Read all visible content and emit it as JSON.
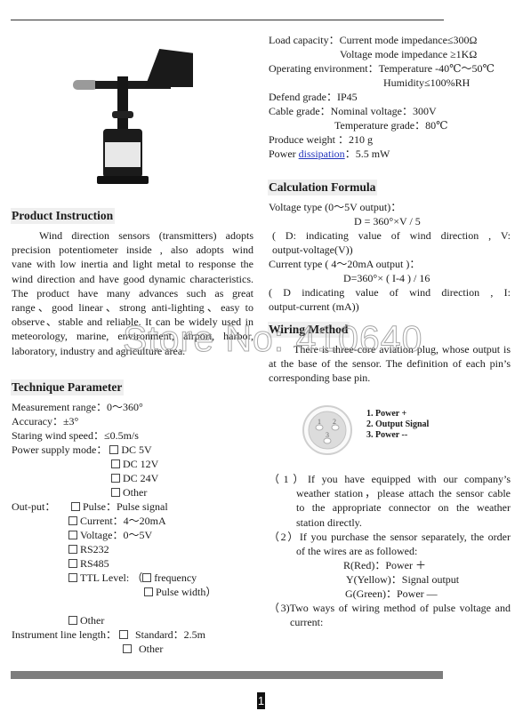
{
  "watermark": "Store No: 410640",
  "page_number": "1",
  "product_photo": {
    "label": "wind direction sensor photo"
  },
  "product_instruction": {
    "heading": "Product Instruction",
    "paragraph_lines": [
      "Wind direction sensors (transmitters) adopts",
      "precision potentiometer inside , also adopts wind",
      "vane with low inertia and light metal to response the",
      "wind direction and have good dynamic characteristics.",
      "The product have many advances such as great",
      "range、good linear、strong anti-lighting、easy to",
      "observe、stable and reliable. It can be widely used in",
      "meteorology, marine, environment, airport, harbor,",
      "laboratory, industry and agriculture area."
    ]
  },
  "technique_parameter": {
    "heading": "Technique Parameter",
    "measurement_range": "Measurement range：0～360°",
    "accuracy": "Accuracy：±3°",
    "starting_wind_speed": "Staring wind speed：≤0.5m/s",
    "power_supply_label": "Power supply mode：",
    "power_supply_options": [
      "DC 5V",
      "DC 12V",
      "DC 24V",
      "Other"
    ],
    "output_label": "Out-put：",
    "output_options": [
      "Pulse：Pulse signal",
      "Current：4～20mA",
      "Voltage：0～5V",
      "RS232",
      "RS485",
      "TTL Level:  （"
    ],
    "ttl_suboptions": [
      "frequency",
      "Pulse width）"
    ],
    "output_other": "Other",
    "line_length_label": "Instrument line length：",
    "line_length_options": [
      "Standard：2.5m",
      "Other"
    ]
  },
  "specs": {
    "load_capacity": "Load capacity：Current mode impedance≤300Ω",
    "load_capacity_2": "Voltage mode impedance ≥1KΩ",
    "operating_env": "Operating environment：Temperature -40℃～50℃",
    "operating_env_2": "Humidity≤100%RH",
    "defend_grade": "Defend grade：IP45",
    "cable_grade": "Cable grade：Nominal voltage：300V",
    "cable_grade_2": "Temperature grade：80℃",
    "weight": "Produce weight ：210 g",
    "power_prefix": "Power ",
    "power_link": "dissipation",
    "power_suffix": "：5.5 mW"
  },
  "calculation_formula": {
    "heading": "Calculation Formula",
    "voltage_type": "Voltage type (0～5V output)：",
    "voltage_formula": "D = 360°×V / 5",
    "voltage_note_1": "( D: indicating value of wind direction , V:",
    "voltage_note_2": "output-voltage(V))",
    "current_type": "Current type ( 4～20mA output )：",
    "current_formula": "D=360°× ( I-4 ) / 16",
    "current_note_1": "( D indicating value of wind direction , I:",
    "current_note_2": "output-current (mA))"
  },
  "wiring_method": {
    "heading": "Wiring Method",
    "intro_lines": [
      "There is three-core aviation plug, whose output is",
      "at the base of the sensor. The definition of each pin’s",
      "corresponding base pin."
    ],
    "pins": [
      "1. Power +",
      "2. Output Signal",
      "3. Power --"
    ],
    "pin_numbers": [
      "1",
      "2",
      "3"
    ],
    "step1_lines": [
      "（1）If you have equipped with our company’s",
      "weather station，please attach the sensor cable",
      "to the appropriate connector on the weather",
      "station directly."
    ],
    "step2_lines": [
      "（2）If you purchase the sensor separately, the order",
      "of the wires are as followed:"
    ],
    "wires": [
      "R(Red)：Power ＋",
      "Y(Yellow)：Signal output",
      "G(Green)：Power —"
    ],
    "step3_lines": [
      "（3)Two ways of wiring method of pulse voltage and",
      "current:"
    ]
  }
}
